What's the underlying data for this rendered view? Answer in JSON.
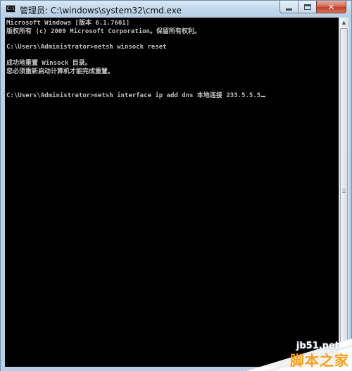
{
  "window": {
    "title": "管理员: C:\\windows\\system32\\cmd.exe",
    "icon": "cmd-icon",
    "icon_text": "C:\\",
    "buttons": {
      "minimize": "minimize-icon",
      "maximize": "maximize-icon",
      "close": "close-icon",
      "close_glyph": "✕"
    }
  },
  "console": {
    "lines": [
      "Microsoft Windows [版本 6.1.7601]",
      "版权所有 (c) 2009 Microsoft Corporation。保留所有权利。",
      "",
      "C:\\Users\\Administrator>netsh winsock reset",
      "",
      "成功地重置 Winsock 目录。",
      "您必须重新启动计算机才能完成重置。",
      "",
      "",
      "C:\\Users\\Administrator>netsh interface ip add dns 本地连接 233.5.5.5"
    ],
    "colors": {
      "background": "#000000",
      "text": "#c0c0c0"
    }
  },
  "scrollbar": {
    "up_arrow": "▲",
    "down_arrow": "▼"
  },
  "watermark": {
    "site": "jb51.net",
    "name": "脚本之家"
  }
}
